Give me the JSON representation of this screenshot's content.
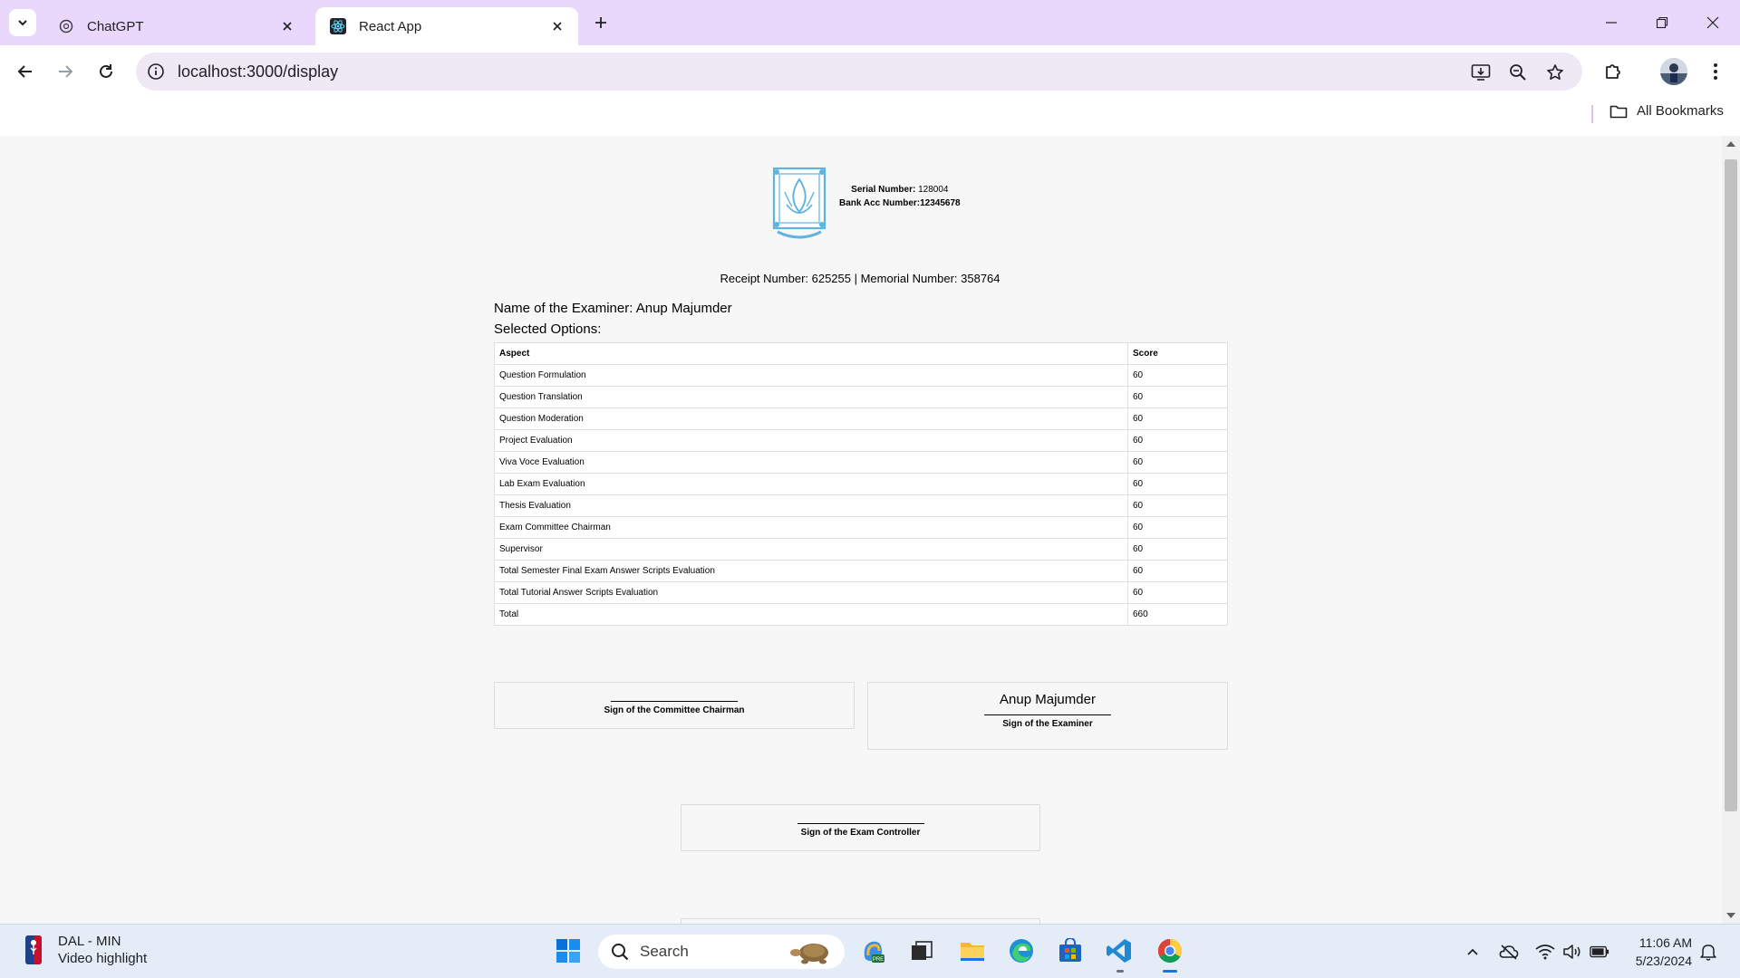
{
  "browser": {
    "tabs": [
      {
        "title": "ChatGPT",
        "active": false
      },
      {
        "title": "React App",
        "active": true
      }
    ],
    "url": "localhost:3000/display",
    "bookmarks_label": "All Bookmarks"
  },
  "page": {
    "serial_label": "Serial Number:",
    "serial_value": "128004",
    "bank_label": "Bank Acc Number:",
    "bank_value": "12345678",
    "receipt_line": "Receipt Number: 625255 | Memorial Number: 358764",
    "examiner_line": "Name of the Examiner: Anup Majumder",
    "selected_options": "Selected Options:",
    "table": {
      "headers": [
        "Aspect",
        "Score"
      ],
      "rows": [
        [
          "Question Formulation",
          "60"
        ],
        [
          "Question Translation",
          "60"
        ],
        [
          "Question Moderation",
          "60"
        ],
        [
          "Project Evaluation",
          "60"
        ],
        [
          "Viva Voce Evaluation",
          "60"
        ],
        [
          "Lab Exam Evaluation",
          "60"
        ],
        [
          "Thesis Evaluation",
          "60"
        ],
        [
          "Exam Committee Chairman",
          "60"
        ],
        [
          "Supervisor",
          "60"
        ],
        [
          "Total Semester Final Exam Answer Scripts Evaluation",
          "60"
        ],
        [
          "Total Tutorial Answer Scripts Evaluation",
          "60"
        ],
        [
          "Total",
          "660"
        ]
      ]
    },
    "signatures": {
      "chairman_label": "Sign of the Committee Chairman",
      "examiner_name": "Anup Majumder",
      "examiner_label": "Sign of the Examiner",
      "controller_label": "Sign of the Exam Controller"
    }
  },
  "taskbar": {
    "widget_title": "DAL - MIN",
    "widget_subtitle": "Video highlight",
    "search_placeholder": "Search",
    "time": "11:06 AM",
    "date": "5/23/2024"
  },
  "colors": {
    "tabstrip_bg": "#e9d8fb",
    "omnibox_bg": "#efe9f6",
    "page_bg": "#f7f7f7",
    "taskbar_bg": "#e3ecf7",
    "logo_blue": "#5fb3e0"
  }
}
